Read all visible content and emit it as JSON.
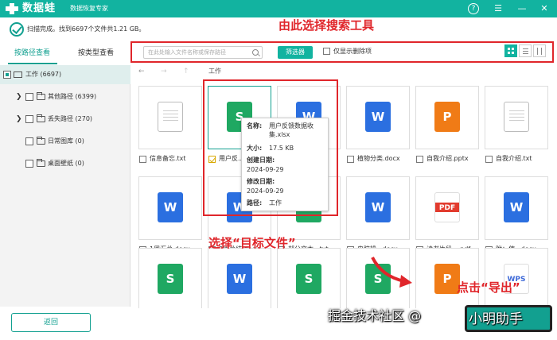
{
  "app": {
    "name": "数据蛙",
    "subtitle": "数据恢复专家"
  },
  "status": {
    "text": "扫描完成。找到6697个文件共1.21 GB。"
  },
  "annotations": {
    "top": "由此选择搜索工具",
    "middle": "选择“目标文件”",
    "right": "点击“导出”",
    "watermark": "掘金技术社区 @",
    "export_label": "小明助手"
  },
  "tabs": [
    {
      "label": "按路径查看",
      "active": true
    },
    {
      "label": "按类型查看",
      "active": false
    }
  ],
  "tree": [
    {
      "label": "工作 (6697)",
      "selected": true
    },
    {
      "label": "其他路径 (6399)",
      "selected": false
    },
    {
      "label": "丢失路径 (270)",
      "selected": false
    },
    {
      "label": "日常图库 (0)",
      "selected": false
    },
    {
      "label": "桌面壁纸 (0)",
      "selected": false
    }
  ],
  "toolbar": {
    "search_placeholder": "在此处输入文件名称或保存路径",
    "filter_label": "筛选器",
    "deleted_only_label": "仅显示删除项"
  },
  "nav": {
    "current": "工作"
  },
  "buttons": {
    "back_label": "返回"
  },
  "files": [
    {
      "name": "信息备忘.txt",
      "type": "txt",
      "checked": false
    },
    {
      "name": "用户反...xlsx",
      "type": "xlsx",
      "checked": true
    },
    {
      "name": "...docx",
      "type": "docx",
      "checked": false
    },
    {
      "name": "植物分类.docx",
      "type": "docx",
      "checked": false
    },
    {
      "name": "自我介绍.pptx",
      "type": "pptx",
      "checked": false
    },
    {
      "name": "自我介绍.txt",
      "type": "txt",
      "checked": false
    },
    {
      "name": "1周汇总.docx",
      "type": "docx",
      "checked": false
    },
    {
      "name": "3周总结.docx",
      "type": "docx",
      "checked": false
    },
    {
      "name": "部分文本...txt",
      "type": "xlsx",
      "checked": false
    },
    {
      "name": "电脑操...docx",
      "type": "docx",
      "checked": false
    },
    {
      "name": "读书片段....pdf",
      "type": "pdf",
      "checked": false
    },
    {
      "name": "附：使...docx",
      "type": "docx",
      "checked": false
    },
    {
      "name": "",
      "type": "xlsx",
      "checked": false
    },
    {
      "name": "",
      "type": "docx",
      "checked": false
    },
    {
      "name": "",
      "type": "xlsx",
      "checked": false
    },
    {
      "name": "",
      "type": "xlsx",
      "checked": false
    },
    {
      "name": "",
      "type": "pptx",
      "checked": false
    },
    {
      "name": "",
      "type": "wps",
      "checked": false
    }
  ],
  "tooltip": {
    "name_label": "名称:",
    "name_value": "用户反馈数据收集.xlsx",
    "size_label": "大小:",
    "size_value": "17.5 KB",
    "created_label": "创建日期:",
    "created_value": "2024-09-29",
    "modified_label": "修改日期:",
    "modified_value": "2024-09-29",
    "path_label": "路径:",
    "path_value": "工作"
  },
  "colors": {
    "accent": "#12b3a0",
    "annotation": "#e0262b"
  }
}
